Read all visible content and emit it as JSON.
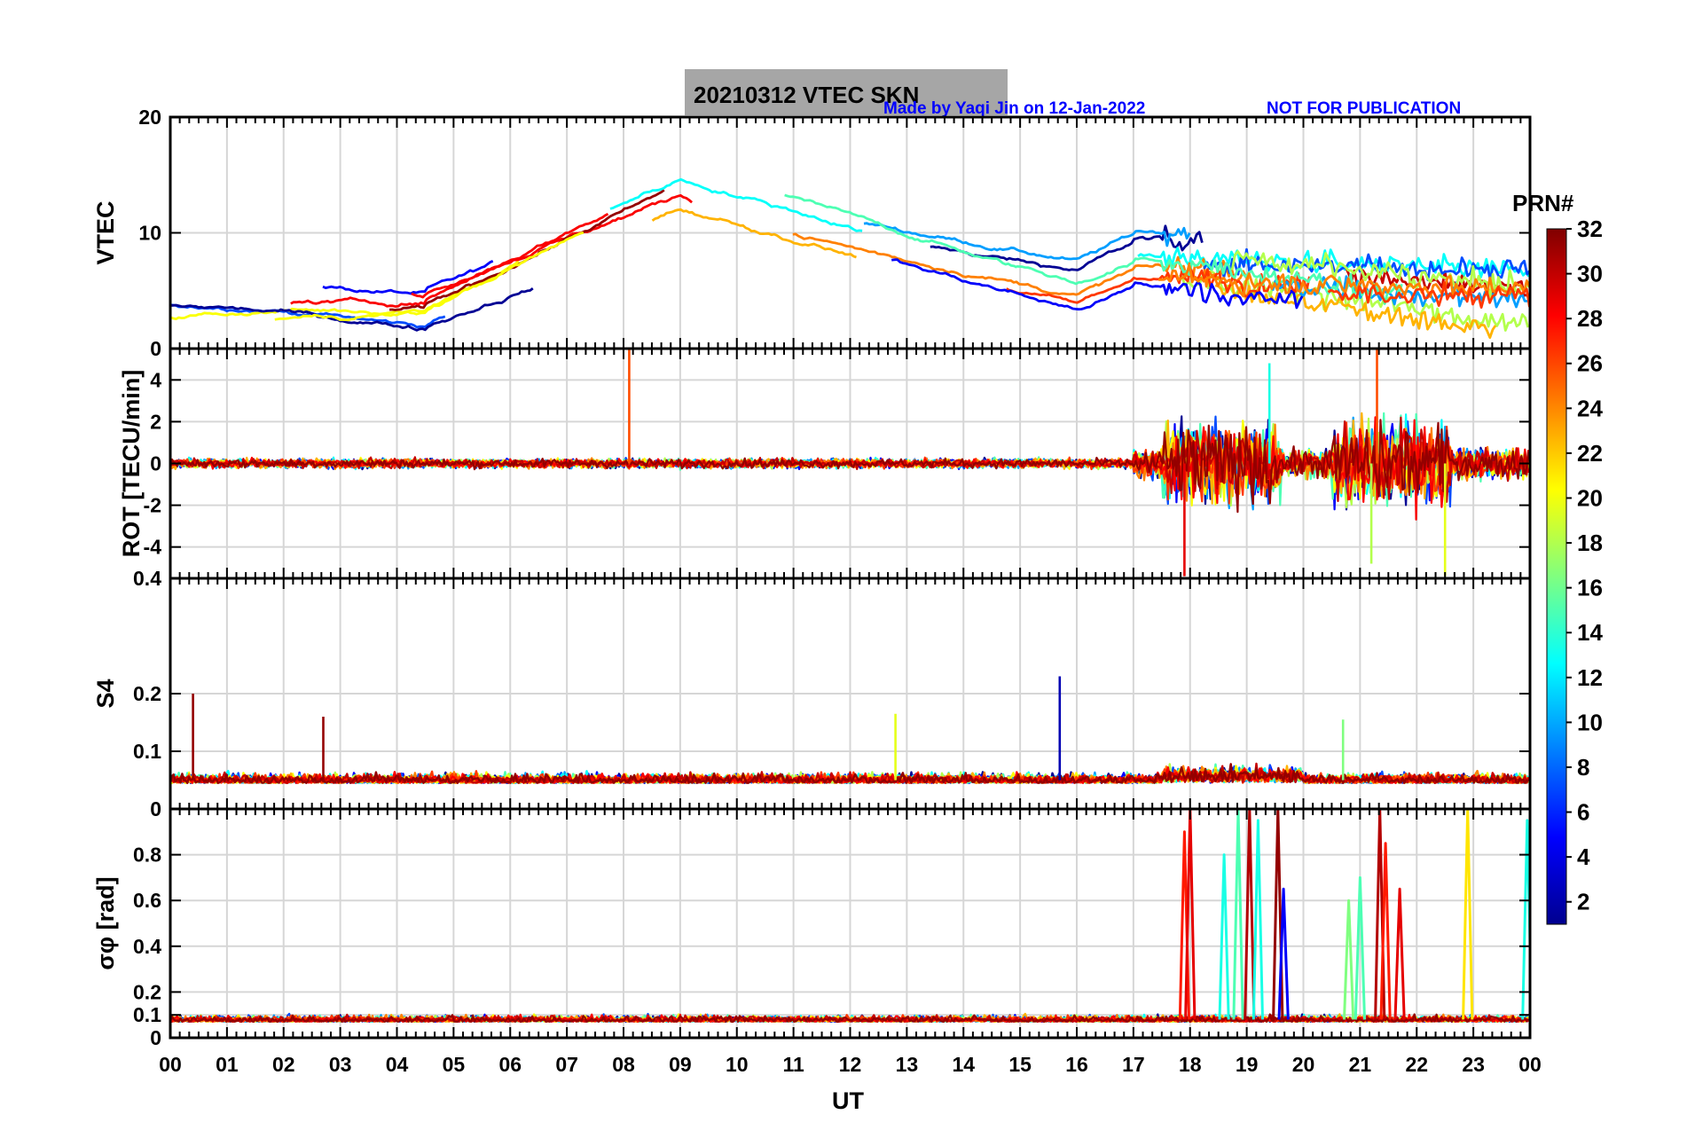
{
  "chart_data": {
    "type": "line",
    "title_box": "20210312    VTEC  SKN",
    "credit_left": "Made by Yaqi Jin on 12-Jan-2022",
    "credit_right": "NOT FOR PUBLICATION",
    "xlabel": "UT",
    "x_tick_labels": [
      "00",
      "01",
      "02",
      "03",
      "04",
      "05",
      "06",
      "07",
      "08",
      "09",
      "10",
      "11",
      "12",
      "13",
      "14",
      "15",
      "16",
      "17",
      "18",
      "19",
      "20",
      "21",
      "22",
      "23",
      "00"
    ],
    "xlim": [
      0,
      24
    ],
    "colorbar": {
      "label": "PRN#",
      "range": [
        1,
        32
      ],
      "tick_labels": [
        "2",
        "4",
        "6",
        "8",
        "10",
        "12",
        "14",
        "16",
        "18",
        "20",
        "22",
        "24",
        "26",
        "28",
        "30",
        "32"
      ],
      "colormap": "jet"
    },
    "panels": [
      {
        "id": "vtec",
        "ylabel": "VTEC",
        "ylim": [
          0,
          20
        ],
        "y_tick_labels": [
          "0",
          "10",
          "20"
        ],
        "y_ticks": [
          0,
          10,
          20
        ],
        "series_summary": "VTEC per PRN, ~4 TECU at 00-04 UT rising to ~15 at 09 UT, ~8-10 around 12-15 UT, ~5 at 16 UT, fluctuating 5-10 from 17-24 UT"
      },
      {
        "id": "rot",
        "ylabel": "ROT [TECU/min]",
        "ylim": [
          -5.5,
          5.5
        ],
        "y_tick_labels": [
          "4",
          "2",
          "0",
          "-2",
          "-4"
        ],
        "y_ticks": [
          4,
          2,
          0,
          -2,
          -4
        ],
        "series_summary": "ROT near 0 through 17 UT, strong fluctuations of ±4 between 17.5-19.5 UT and 20.5-22.5 UT"
      },
      {
        "id": "s4",
        "ylabel": "S4",
        "ylim": [
          0,
          0.4
        ],
        "y_tick_labels": [
          "0",
          "0.1",
          "0.2",
          "0.4"
        ],
        "y_ticks": [
          0,
          0.1,
          0.2,
          0.4
        ],
        "series_summary": "S4 around 0.04-0.08 all day, spikes to 0.2 at 0.4 UT and 0.23 at 15.7 UT"
      },
      {
        "id": "sigphi",
        "ylabel": "σφ [rad]",
        "ylim": [
          0,
          1
        ],
        "y_tick_labels": [
          "0",
          "0.1",
          "0.2",
          "0.4",
          "0.6",
          "0.8"
        ],
        "y_ticks": [
          0,
          0.1,
          0.2,
          0.4,
          0.6,
          0.8
        ],
        "series_summary": "Sigma-phi ~0.05-0.12 most of the day, bursts up to 1.0 near 18-19.6 UT and 21-21.6 UT, 23 UT and 24 UT"
      }
    ]
  }
}
